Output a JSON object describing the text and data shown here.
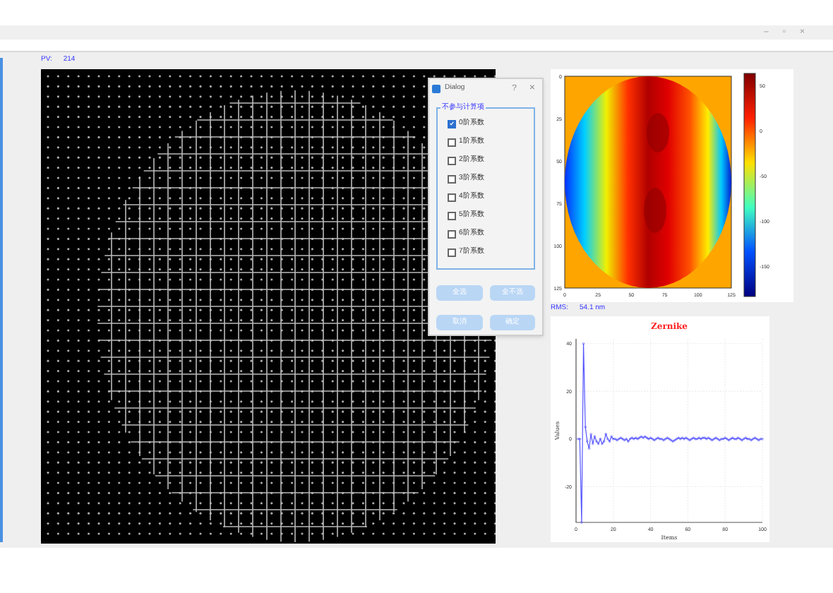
{
  "window": {
    "controls": [
      "–",
      "▫",
      "×"
    ]
  },
  "left_panel": {
    "label": "PV:",
    "value": "214"
  },
  "heatmap": {
    "yticks": [
      "0",
      "25",
      "50",
      "75",
      "100",
      "125"
    ],
    "xticks": [
      "0",
      "25",
      "50",
      "75",
      "100",
      "125"
    ],
    "colorbar_ticks": [
      "50",
      "0",
      "-50",
      "-100",
      "-150"
    ]
  },
  "rms": {
    "label": "RMS:",
    "value": "54.1 nm"
  },
  "zernike": {
    "chart_data": {
      "type": "line",
      "title": "Zernike",
      "xlabel": "Items",
      "ylabel": "Values",
      "grid": true,
      "xlim": [
        0,
        100
      ],
      "ylim": [
        -35,
        42
      ],
      "xticks": [
        0,
        20,
        40,
        60,
        80,
        100
      ],
      "yticks": [
        -20,
        0,
        20,
        40
      ],
      "x": [
        1,
        2,
        3,
        4,
        5,
        6,
        7,
        8,
        9,
        10,
        11,
        12,
        13,
        14,
        15,
        16,
        17,
        18,
        19,
        20,
        21,
        22,
        23,
        24,
        25,
        26,
        27,
        28,
        29,
        30,
        31,
        32,
        33,
        34,
        35,
        36,
        37,
        38,
        39,
        40,
        41,
        42,
        43,
        44,
        45,
        46,
        47,
        48,
        49,
        50,
        51,
        52,
        53,
        54,
        55,
        56,
        57,
        58,
        59,
        60,
        61,
        62,
        63,
        64,
        65,
        66,
        67,
        68,
        69,
        70,
        71,
        72,
        73,
        74,
        75,
        76,
        77,
        78,
        79,
        80,
        81,
        82,
        83,
        84,
        85,
        86,
        87,
        88,
        89,
        90,
        91,
        92,
        93,
        94,
        95,
        96,
        97,
        98,
        99,
        100
      ],
      "series": [
        {
          "color": "#5555ff",
          "marker": "circle",
          "values": [
            0,
            0,
            -35,
            40,
            5,
            -1,
            -4,
            2,
            -2,
            1,
            -1,
            -2,
            0,
            -2,
            -1,
            2,
            0,
            -1,
            1,
            0,
            0,
            -0.5,
            0,
            0.5,
            0,
            -0.5,
            0,
            -1,
            0,
            0.5,
            0,
            0.5,
            0,
            0.5,
            1,
            0.5,
            1,
            0.5,
            0,
            0.5,
            0,
            -0.5,
            0,
            0.5,
            0,
            0,
            -0.5,
            0,
            0.5,
            0,
            -0.5,
            -1,
            -0.5,
            0,
            0.5,
            0,
            0.5,
            0,
            0.5,
            0,
            -0.5,
            0,
            0.5,
            0,
            0,
            0.5,
            0,
            0.5,
            0.5,
            0,
            0.5,
            0,
            -0.5,
            0,
            0.5,
            0,
            -0.5,
            0,
            0,
            0.5,
            0,
            -0.5,
            0,
            0.5,
            0,
            0,
            0.5,
            0,
            -0.5,
            0,
            0.5,
            0,
            0,
            -0.5,
            0,
            0.5,
            0,
            -0.5,
            0,
            0
          ]
        }
      ]
    }
  },
  "dialog": {
    "title": "Dialog",
    "help": "?",
    "close": "×",
    "group": "不参与计算项",
    "options": [
      {
        "label": "0阶系数",
        "checked": true
      },
      {
        "label": "1阶系数",
        "checked": false
      },
      {
        "label": "2阶系数",
        "checked": false
      },
      {
        "label": "3阶系数",
        "checked": false
      },
      {
        "label": "4阶系数",
        "checked": false
      },
      {
        "label": "5阶系数",
        "checked": false
      },
      {
        "label": "6阶系数",
        "checked": false
      },
      {
        "label": "7阶系数",
        "checked": false
      }
    ],
    "buttons": [
      "全选",
      "全不选",
      "取消",
      "确定"
    ]
  }
}
